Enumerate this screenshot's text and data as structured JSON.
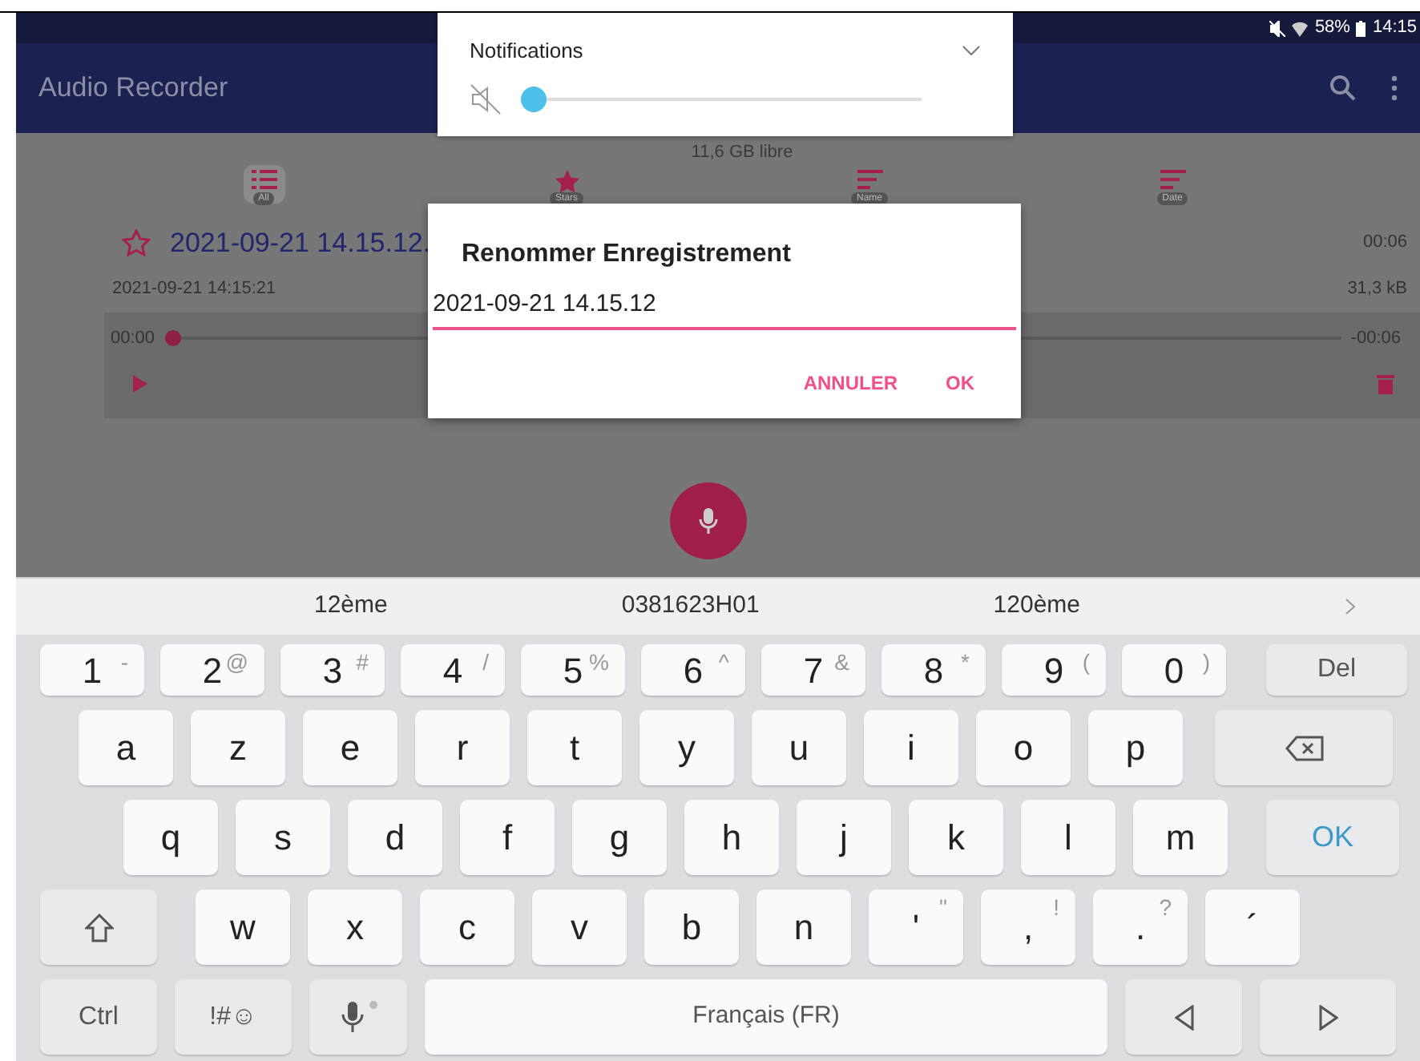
{
  "status_bar": {
    "battery": "58%",
    "time": "14:15"
  },
  "app_bar": {
    "title": "Audio Recorder"
  },
  "notification_panel": {
    "title": "Notifications",
    "muted": true,
    "level": 0
  },
  "storage": "11,6 GB libre",
  "filters": [
    {
      "kind": "list",
      "label": "All",
      "selected": true
    },
    {
      "kind": "star",
      "label": "Stars",
      "selected": false
    },
    {
      "kind": "name",
      "label": "Name",
      "selected": false
    },
    {
      "kind": "date",
      "label": "Date",
      "selected": false
    }
  ],
  "recording": {
    "starred": false,
    "title": "2021-09-21 14.15.12.",
    "date": "2021-09-21 14:15:21",
    "duration": "00:06",
    "size": "31,3 kB",
    "position": "00:00",
    "remaining": "-00:06",
    "level": 0
  },
  "dialog": {
    "title": "Renommer Enregistrement",
    "value": "2021-09-21 14.15.12",
    "buttons": [
      "ANNULER",
      "OK"
    ]
  },
  "suggestions": [
    "12ème",
    "0381623H01",
    "120ème"
  ],
  "keyboard": [
    [
      {
        "kind": "num",
        "label": "1",
        "alt": "-"
      },
      {
        "kind": "num",
        "label": "2",
        "alt": "@"
      },
      {
        "kind": "num",
        "label": "3",
        "alt": "#"
      },
      {
        "kind": "num",
        "label": "4",
        "alt": "/"
      },
      {
        "kind": "num",
        "label": "5",
        "alt": "%"
      },
      {
        "kind": "num",
        "label": "6",
        "alt": "^"
      },
      {
        "kind": "num",
        "label": "7",
        "alt": "&"
      },
      {
        "kind": "num",
        "label": "8",
        "alt": "*"
      },
      {
        "kind": "num",
        "label": "9",
        "alt": "("
      },
      {
        "kind": "num",
        "label": "0",
        "alt": ")"
      },
      {
        "kind": "action",
        "label": "Del"
      }
    ],
    [
      {
        "kind": "char",
        "label": "a"
      },
      {
        "kind": "char",
        "label": "z"
      },
      {
        "kind": "char",
        "label": "e"
      },
      {
        "kind": "char",
        "label": "r"
      },
      {
        "kind": "char",
        "label": "t"
      },
      {
        "kind": "char",
        "label": "y"
      },
      {
        "kind": "char",
        "label": "u"
      },
      {
        "kind": "char",
        "label": "i"
      },
      {
        "kind": "char",
        "label": "o"
      },
      {
        "kind": "char",
        "label": "p"
      },
      {
        "kind": "backspace"
      }
    ],
    [
      {
        "kind": "char",
        "label": "q"
      },
      {
        "kind": "char",
        "label": "s"
      },
      {
        "kind": "char",
        "label": "d"
      },
      {
        "kind": "char",
        "label": "f"
      },
      {
        "kind": "char",
        "label": "g"
      },
      {
        "kind": "char",
        "label": "h"
      },
      {
        "kind": "char",
        "label": "j"
      },
      {
        "kind": "char",
        "label": "k"
      },
      {
        "kind": "char",
        "label": "l"
      },
      {
        "kind": "char",
        "label": "m"
      },
      {
        "kind": "enter",
        "label": "OK"
      }
    ],
    [
      {
        "kind": "shift"
      },
      {
        "kind": "char",
        "label": "w"
      },
      {
        "kind": "char",
        "label": "x"
      },
      {
        "kind": "char",
        "label": "c"
      },
      {
        "kind": "char",
        "label": "v"
      },
      {
        "kind": "char",
        "label": "b"
      },
      {
        "kind": "char",
        "label": "n"
      },
      {
        "kind": "char",
        "label": "'",
        "alt": "\""
      },
      {
        "kind": "char",
        "label": ",",
        "alt": "!"
      },
      {
        "kind": "char",
        "label": ".",
        "alt": "?"
      },
      {
        "kind": "char",
        "label": "´"
      }
    ],
    [
      {
        "kind": "action",
        "label": "Ctrl"
      },
      {
        "kind": "action",
        "label": "!#☺"
      },
      {
        "kind": "mic"
      },
      {
        "kind": "space",
        "label": "Français (FR)"
      },
      {
        "kind": "left"
      },
      {
        "kind": "right"
      }
    ]
  ]
}
